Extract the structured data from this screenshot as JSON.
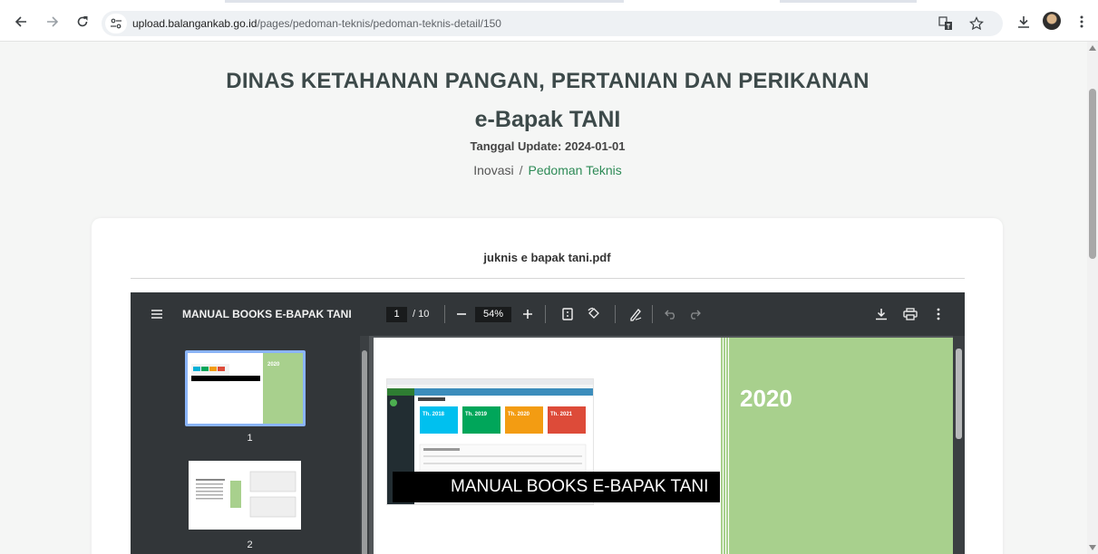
{
  "browser": {
    "url_host": "upload.balangankab.go.id",
    "url_path": "/pages/pedoman-teknis/pedoman-teknis-detail/150"
  },
  "page": {
    "agency": "DINAS KETAHANAN PANGAN, PERTANIAN DAN PERIKANAN",
    "app_name": "e-Bapak TANI",
    "update_label": "Tanggal Update: 2024-01-01",
    "breadcrumb": {
      "parent": "Inovasi",
      "separator": "/",
      "current": "Pedoman Teknis"
    }
  },
  "document": {
    "file_name": "juknis e bapak tani.pdf"
  },
  "pdf_viewer": {
    "title": "MANUAL BOOKS E-BAPAK TANI",
    "current_page": "1",
    "total_pages": "/ 10",
    "zoom": "54%",
    "thumbnails": [
      {
        "number": "1"
      },
      {
        "number": "2"
      }
    ],
    "page1": {
      "year": "2020",
      "banner": "MANUAL BOOKS E-BAPAK TANI"
    }
  },
  "colors": {
    "accent_link": "#2e8b57",
    "pdf_toolbar": "#323639",
    "cover_green": "#a8d08d"
  }
}
